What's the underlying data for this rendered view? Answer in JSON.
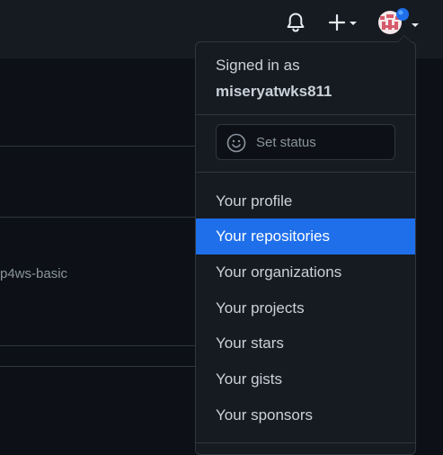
{
  "header": {
    "icons": [
      "bell-icon",
      "plus-icon",
      "chevron-down-icon",
      "avatar"
    ],
    "notification_dot_color": "#1f6feb"
  },
  "background": {
    "repo_fragment": "p4ws-basic"
  },
  "dropdown": {
    "signed_in_label": "Signed in as",
    "username": "miseryatwks811",
    "status_placeholder": "Set status",
    "menu_items": [
      "Your profile",
      "Your repositories",
      "Your organizations",
      "Your projects",
      "Your stars",
      "Your gists",
      "Your sponsors"
    ],
    "active_item": "Your repositories",
    "accent_color": "#1f6feb"
  }
}
